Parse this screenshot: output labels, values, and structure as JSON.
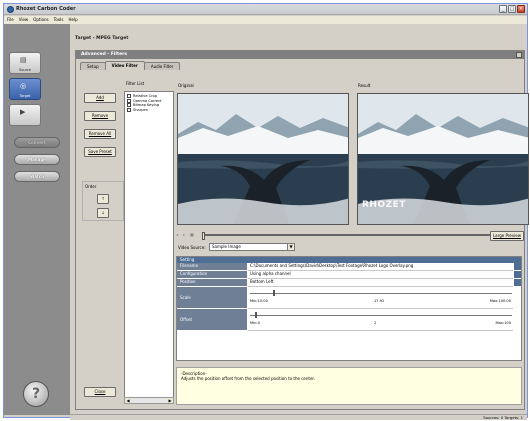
{
  "window": {
    "title": "Rhozet Carbon Coder"
  },
  "menu": [
    "File",
    "View",
    "Options",
    "Tools",
    "Help"
  ],
  "nav": {
    "tiles": [
      {
        "label": "Source",
        "icon": "source-icon",
        "glyph": "▤"
      },
      {
        "label": "Target",
        "icon": "target-icon",
        "glyph": "◎"
      },
      {
        "label": "",
        "icon": "convert-icon",
        "glyph": "▶"
      }
    ],
    "pills": [
      "Convert",
      "Manage",
      "Watch"
    ],
    "help": "?"
  },
  "target_title": "Target - MPEG Target",
  "panel": {
    "title": "Advanced - Filters",
    "tabs": [
      "Setup",
      "Video Filter",
      "Audio Filter"
    ],
    "active_tab": "Video Filter"
  },
  "buttons": {
    "add": "Add",
    "remove": "Remove",
    "remove_all": "Remove All",
    "save_preset": "Save Preset",
    "close": "Close",
    "up": "↑",
    "down": "↓",
    "large_preview": "Large Preview"
  },
  "labels": {
    "filter_list": "Filter List",
    "original": "Original",
    "result": "Result",
    "order": "Order",
    "video_source": "Video Source:",
    "setting": "Setting"
  },
  "filters": [
    {
      "name": "Relative Crop",
      "checked": false
    },
    {
      "name": "Gamma Correct",
      "checked": false
    },
    {
      "name": "Bitmap Keying",
      "checked": false
    },
    {
      "name": "Sharpen",
      "checked": false
    }
  ],
  "video_source": {
    "value": "Sample Image"
  },
  "watermark": "RHOZET",
  "settings": {
    "filename": {
      "key": "Filename",
      "value": "C:\\Documents and Settings\\David\\Desktop\\Test Footage\\Rhozet Logo Overlay.png"
    },
    "configuration": {
      "key": "Configuration",
      "value": "Using alpha channel"
    },
    "position": {
      "key": "Position",
      "value": "Bottom Left"
    },
    "scale": {
      "key": "Scale",
      "min": "Min:10.00",
      "current": "17.92",
      "max": "Max:100.00",
      "value_fraction": 0.088
    },
    "offset": {
      "key": "Offset",
      "min": "Min:0",
      "current": "2",
      "max": "Max:100",
      "value_fraction": 0.02
    }
  },
  "description": {
    "heading": "-Description-",
    "text": "Adjusts the position offset from the selected position to the center."
  },
  "status": {
    "text": "Sources: 0   Targets: 1"
  },
  "colors": {
    "nav_bg": "#8c8c8c",
    "accent": "#4e6e96",
    "selected_tile": "#3a62aa",
    "desc_bg": "#ffffe1"
  }
}
